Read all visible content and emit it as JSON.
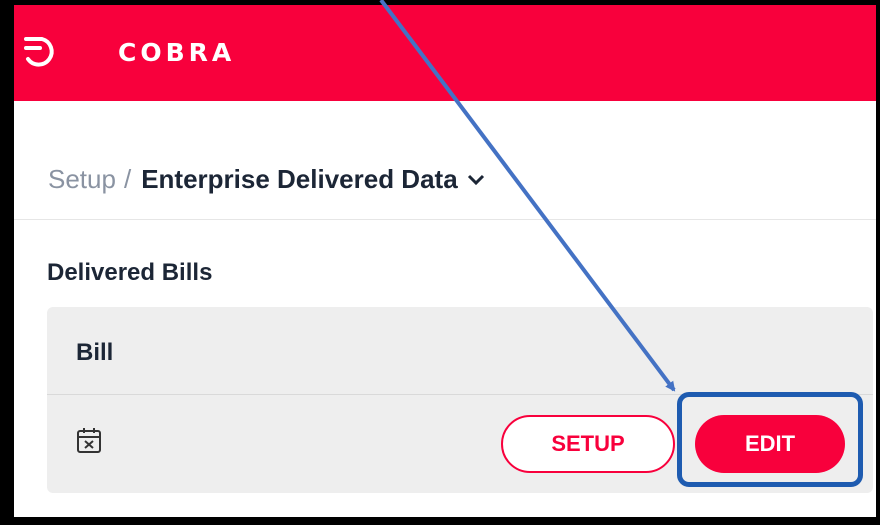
{
  "app": {
    "brand": "COBRA",
    "brand_color": "#f8003c"
  },
  "breadcrumb": {
    "root": "Setup",
    "separator": "/",
    "current": "Enterprise Delivered Data"
  },
  "section": {
    "title": "Delivered Bills"
  },
  "card": {
    "title": "Bill",
    "icon": "calendar-x-icon",
    "setup_label": "SETUP",
    "edit_label": "EDIT"
  },
  "annotation": {
    "color": "#1e5bb0",
    "target": "edit-button"
  }
}
